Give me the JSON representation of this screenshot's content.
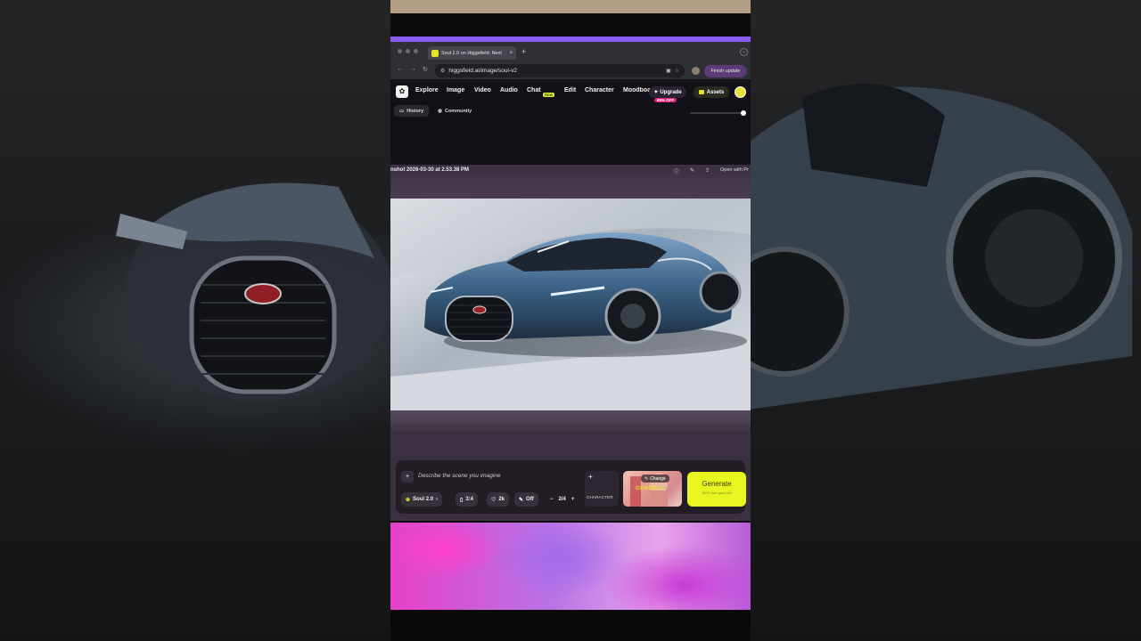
{
  "browser": {
    "tab_title": "Soul 2.0 on Higgsfield: Next",
    "tab_close": "×",
    "new_tab": "+",
    "url": "higgsfield.ai/image/soul-v2",
    "finish_update": "Finish update"
  },
  "nav": {
    "items": [
      "Explore",
      "Image",
      "Video",
      "Audio",
      "Chat",
      "Edit",
      "Character",
      "Moodboard"
    ],
    "chat_badge": "New",
    "upgrade": "Upgrade",
    "discount": "65% OFF",
    "assets": "Assets"
  },
  "subtabs": [
    "History",
    "Community"
  ],
  "viewer": {
    "filename": "nshot 2026-03-30 at 2.53.38 PM",
    "open_with": "Open with Pr"
  },
  "composer": {
    "prompt_placeholder": "Describe the scene you imagine",
    "model": "Soul 2.0",
    "aspect": "3:4",
    "quality": "2k",
    "enhance": "Off",
    "batch": "2/4",
    "character_label": "CHARACTER",
    "change": "Change",
    "preset": "GENERAL",
    "generate": "Generate",
    "generate_sub": "487K free gens left"
  },
  "colors": {
    "accent_yellow": "#e8f51e",
    "discount_pink": "#e11d74",
    "browser_purple": "#8b5cf6"
  }
}
